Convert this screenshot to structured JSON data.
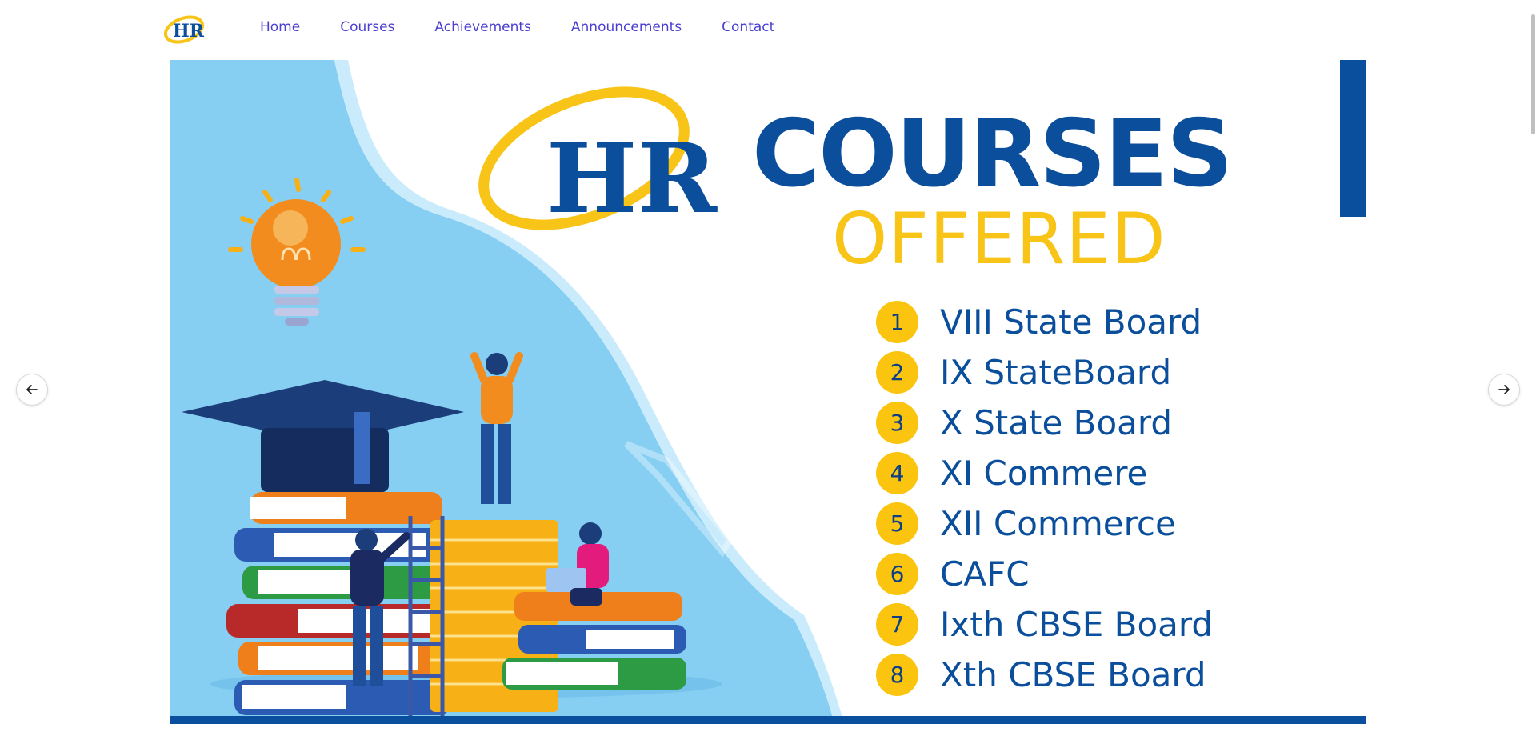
{
  "nav": {
    "links": [
      {
        "label": "Home"
      },
      {
        "label": "Courses"
      },
      {
        "label": "Achievements"
      },
      {
        "label": "Announcements"
      },
      {
        "label": "Contact"
      }
    ]
  },
  "hero": {
    "title": "COURSES",
    "subtitle": "OFFERED",
    "logo_letters": "HR",
    "courses": [
      {
        "num": "1",
        "name": "VIII State Board"
      },
      {
        "num": "2",
        "name": "IX StateBoard"
      },
      {
        "num": "3",
        "name": "X State Board"
      },
      {
        "num": "4",
        "name": "XI Commere"
      },
      {
        "num": "5",
        "name": "XII Commerce"
      },
      {
        "num": "6",
        "name": "CAFC"
      },
      {
        "num": "7",
        "name": "Ixth CBSE Board"
      },
      {
        "num": "8",
        "name": "Xth CBSE Board"
      }
    ]
  },
  "carousel": {
    "prev_icon": "arrow-left-icon",
    "next_icon": "arrow-right-icon"
  },
  "colors": {
    "brand_blue": "#0b4f9c",
    "brand_yellow": "#f7c417",
    "nav_link": "#4a3fd1",
    "sky": "#86cff3"
  }
}
